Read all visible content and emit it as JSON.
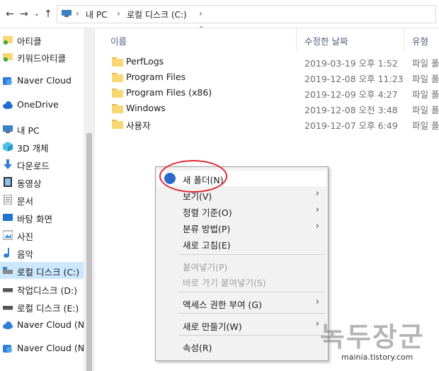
{
  "address": {
    "crumbs": [
      "내 PC",
      "로컬 디스크 (C:)"
    ]
  },
  "sidebar": {
    "items": [
      {
        "label": "아티클",
        "icon": "folder-check-icon"
      },
      {
        "label": "키워드아티클",
        "icon": "folder-check-icon"
      },
      {
        "label": "Naver Cloud",
        "icon": "cloud-icon"
      },
      {
        "label": "OneDrive",
        "icon": "onedrive-icon"
      },
      {
        "label": "내 PC",
        "icon": "pc-icon"
      },
      {
        "label": "3D 개체",
        "icon": "cube-icon"
      },
      {
        "label": "다운로드",
        "icon": "download-icon"
      },
      {
        "label": "동영상",
        "icon": "video-icon"
      },
      {
        "label": "문서",
        "icon": "document-icon"
      },
      {
        "label": "바탕 화면",
        "icon": "desktop-icon"
      },
      {
        "label": "사진",
        "icon": "picture-icon"
      },
      {
        "label": "음악",
        "icon": "music-icon"
      },
      {
        "label": "로컬 디스크 (C:)",
        "icon": "drive-icon"
      },
      {
        "label": "작업디스크 (D:)",
        "icon": "drive-icon"
      },
      {
        "label": "로컬 디스크 (E:)",
        "icon": "drive-icon"
      },
      {
        "label": "Naver Cloud (N:)",
        "icon": "cloud-icon"
      },
      {
        "label": "Naver Cloud (N:)",
        "icon": "cloud-icon"
      }
    ]
  },
  "columns": {
    "name": "이름",
    "date": "수정한 날짜",
    "type": "유형"
  },
  "files": [
    {
      "name": "PerfLogs",
      "date": "2019-03-19 오후 1:52",
      "type": "파일 폴"
    },
    {
      "name": "Program Files",
      "date": "2019-12-08 오후 11:23",
      "type": "파일 폴"
    },
    {
      "name": "Program Files (x86)",
      "date": "2019-12-09 오후 4:27",
      "type": "파일 폴"
    },
    {
      "name": "Windows",
      "date": "2019-12-08 오전 3:48",
      "type": "파일 폴"
    },
    {
      "name": "사용자",
      "date": "2019-12-07 오후 6:49",
      "type": "파일 폴"
    }
  ],
  "context_menu": {
    "new_folder": "새 폴더(N)",
    "view": "보기(V)",
    "sort": "정렬 기준(O)",
    "group": "분류 방법(P)",
    "refresh": "새로 고침(E)",
    "paste": "붙여넣기(P)",
    "paste_shortcut": "바로 가기 붙여넣기(S)",
    "access": "액세스 권한 부여 (G)",
    "new": "새로 만들기(W)",
    "properties": "속성(R)"
  },
  "watermark": {
    "title": "녹두장군",
    "url": "mainia.tistory.com"
  },
  "colors": {
    "selection": "#cce8ff",
    "folder": "#f8d775",
    "annotation": "#e2272f"
  }
}
